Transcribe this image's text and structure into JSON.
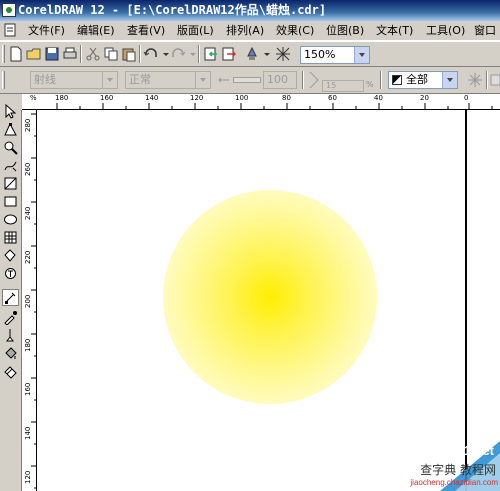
{
  "window": {
    "title": "CorelDRAW 12 - [E:\\CorelDRAW12作品\\蜡烛.cdr]"
  },
  "menu": [
    {
      "label": "文件",
      "accel": "(F)"
    },
    {
      "label": "编辑",
      "accel": "(E)"
    },
    {
      "label": "查看",
      "accel": "(V)"
    },
    {
      "label": "版面",
      "accel": "(L)"
    },
    {
      "label": "排列",
      "accel": "(A)"
    },
    {
      "label": "效果",
      "accel": "(C)"
    },
    {
      "label": "位图",
      "accel": "(B)"
    },
    {
      "label": "文本",
      "accel": "(T)"
    },
    {
      "label": "工具",
      "accel": "(O)"
    },
    {
      "label": "窗口",
      "accel": ""
    }
  ],
  "toolbar": {
    "zoom_level": "150%"
  },
  "property_bar": {
    "font_dropdown": "射线",
    "mode_dropdown": "正常",
    "midpoint_value": "100",
    "angle_value": "15",
    "angle_unit": "%",
    "target_dropdown": "全部"
  },
  "rulers": {
    "horizontal_ticks": [
      "180",
      "160",
      "140",
      "120",
      "100",
      "80",
      "60",
      "40",
      "20",
      "0"
    ],
    "vertical_ticks": [
      "280",
      "260",
      "240",
      "220",
      "200",
      "180",
      "160",
      "140",
      "120"
    ],
    "unit_symbol": "%"
  },
  "watermark": {
    "line1": "jb51.net",
    "line2": "查字典 教程网",
    "line3": "jiaocheng.chazidian.com"
  },
  "colors": {
    "title_bar": "#0a246a",
    "gradient_center": "#ffee00",
    "gradient_edge": "#ffffff",
    "chrome": "#d4d0c8"
  }
}
